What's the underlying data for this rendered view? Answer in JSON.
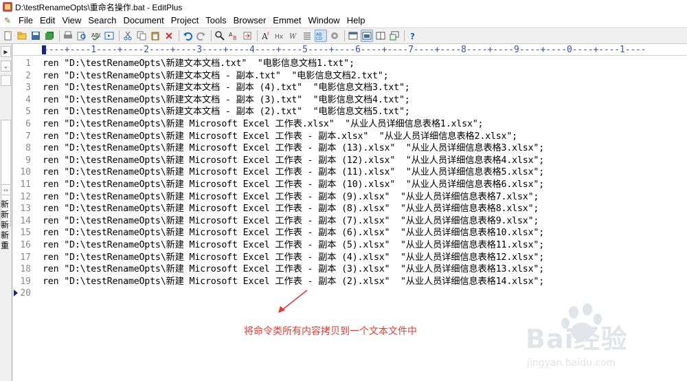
{
  "window": {
    "title": "D:\\testRenameOpts\\重命名操作.bat - EditPlus"
  },
  "menu": [
    "File",
    "Edit",
    "View",
    "Search",
    "Document",
    "Project",
    "Tools",
    "Browser",
    "Emmet",
    "Window",
    "Help"
  ],
  "toolbar": {
    "icons": [
      "new-file-icon",
      "open-folder-icon",
      "save-icon",
      "save-all-icon",
      "print-icon",
      "print-preview-icon",
      "spell-check-icon",
      "browser-preview-icon",
      "cut-icon",
      "copy-icon",
      "paste-icon",
      "delete-icon",
      "undo-icon",
      "redo-icon",
      "find-icon",
      "replace-icon",
      "goto-icon",
      "font-icon",
      "hex-icon",
      "word-wrap-icon",
      "line-number-icon",
      "column-select-icon",
      "settings-icon",
      "window-1-icon",
      "window-2-icon",
      "window-3-icon",
      "window-4-icon",
      "help-icon"
    ]
  },
  "left_panel": {
    "files": [
      "新",
      "新",
      "新",
      "新",
      "重"
    ]
  },
  "ruler": {
    "text": "----+----1----+----2----+----3----+----4----+----5----+----6----+----7----+----8----+----9----+----0----+----1----"
  },
  "editor": {
    "line_numbers": [
      "1",
      "2",
      "3",
      "4",
      "5",
      "6",
      "7",
      "8",
      "9",
      "10",
      "11",
      "12",
      "13",
      "14",
      "15",
      "16",
      "17",
      "18",
      "19",
      "20"
    ],
    "lines": [
      "ren \"D:\\testRenameOpts\\新建文本文档.txt\"  \"电影信息文档1.txt\";",
      "ren \"D:\\testRenameOpts\\新建文本文档 - 副本.txt\"  \"电影信息文档2.txt\";",
      "ren \"D:\\testRenameOpts\\新建文本文档 - 副本 (4).txt\"  \"电影信息文档3.txt\";",
      "ren \"D:\\testRenameOpts\\新建文本文档 - 副本 (3).txt\"  \"电影信息文档4.txt\";",
      "ren \"D:\\testRenameOpts\\新建文本文档 - 副本 (2).txt\"  \"电影信息文档5.txt\";",
      "ren \"D:\\testRenameOpts\\新建 Microsoft Excel 工作表.xlsx\"  \"从业人员详细信息表格1.xlsx\";",
      "ren \"D:\\testRenameOpts\\新建 Microsoft Excel 工作表 - 副本.xlsx\"  \"从业人员详细信息表格2.xlsx\";",
      "ren \"D:\\testRenameOpts\\新建 Microsoft Excel 工作表 - 副本 (13).xlsx\"  \"从业人员详细信息表格3.xlsx\";",
      "ren \"D:\\testRenameOpts\\新建 Microsoft Excel 工作表 - 副本 (12).xlsx\"  \"从业人员详细信息表格4.xlsx\";",
      "ren \"D:\\testRenameOpts\\新建 Microsoft Excel 工作表 - 副本 (11).xlsx\"  \"从业人员详细信息表格5.xlsx\";",
      "ren \"D:\\testRenameOpts\\新建 Microsoft Excel 工作表 - 副本 (10).xlsx\"  \"从业人员详细信息表格6.xlsx\";",
      "ren \"D:\\testRenameOpts\\新建 Microsoft Excel 工作表 - 副本 (9).xlsx\"  \"从业人员详细信息表格7.xlsx\";",
      "ren \"D:\\testRenameOpts\\新建 Microsoft Excel 工作表 - 副本 (8).xlsx\"  \"从业人员详细信息表格8.xlsx\";",
      "ren \"D:\\testRenameOpts\\新建 Microsoft Excel 工作表 - 副本 (7).xlsx\"  \"从业人员详细信息表格9.xlsx\";",
      "ren \"D:\\testRenameOpts\\新建 Microsoft Excel 工作表 - 副本 (6).xlsx\"  \"从业人员详细信息表格10.xlsx\";",
      "ren \"D:\\testRenameOpts\\新建 Microsoft Excel 工作表 - 副本 (5).xlsx\"  \"从业人员详细信息表格11.xlsx\";",
      "ren \"D:\\testRenameOpts\\新建 Microsoft Excel 工作表 - 副本 (4).xlsx\"  \"从业人员详细信息表格12.xlsx\";",
      "ren \"D:\\testRenameOpts\\新建 Microsoft Excel 工作表 - 副本 (3).xlsx\"  \"从业人员详细信息表格13.xlsx\";",
      "ren \"D:\\testRenameOpts\\新建 Microsoft Excel 工作表 - 副本 (2).xlsx\"  \"从业人员详细信息表格14.xlsx\";",
      ""
    ]
  },
  "annotation": {
    "text": "将命令类所有内容拷贝到一个文本文件中",
    "color": "#e53935"
  },
  "watermark": {
    "logo": "Bai经验",
    "url": "jingyan.baidu.com"
  }
}
